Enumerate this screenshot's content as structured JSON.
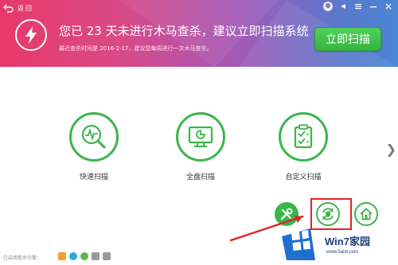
{
  "header": {
    "back_label": "返回",
    "headline": "您已 23 天未进行木马查杀，建议立即扫描系统",
    "subtext": "最近查杀时间是 2016-2-17，建议您每周进行一次木马查杀。",
    "scan_button": "立即扫描",
    "window_controls": [
      "avatar",
      "notification-icon",
      "menu-icon",
      "minimize-icon",
      "close-icon"
    ]
  },
  "scan_options": [
    {
      "label": "快速扫描",
      "icon": "quick-scan-icon"
    },
    {
      "label": "全盘扫描",
      "icon": "full-scan-icon"
    },
    {
      "label": "自定义扫描",
      "icon": "custom-scan-icon"
    }
  ],
  "tools": [
    "wrench-screwdriver-icon",
    "sync-shield-icon",
    "house-shield-icon"
  ],
  "footer": {
    "engines_label": "已启用查杀引擎："
  },
  "watermark": {
    "title": "Win7家园",
    "url": "www.5aixt.com"
  },
  "colors": {
    "accent_green": "#3bb54a",
    "banner_start": "#e8386a",
    "banner_end": "#4a86d4",
    "highlight_red": "#e02424"
  }
}
